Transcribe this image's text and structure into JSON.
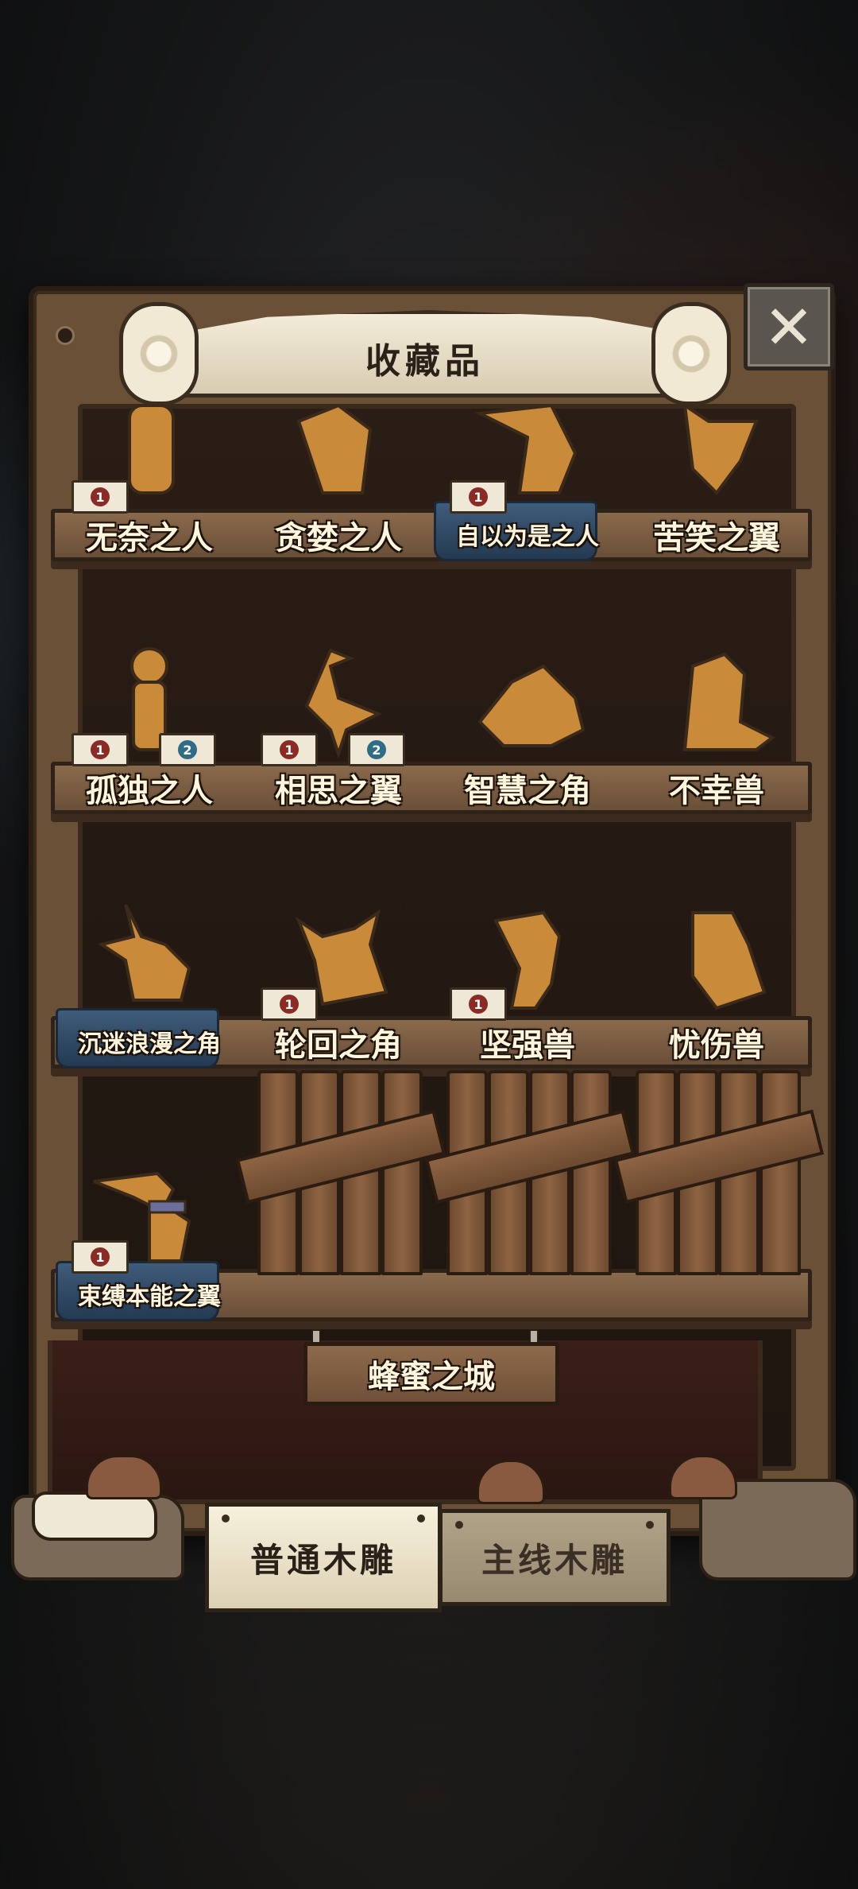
{
  "header": {
    "title": "收藏品",
    "close_icon": "close-x-icon"
  },
  "shelves": [
    {
      "items": [
        {
          "name": "无奈之人",
          "icon": "statue-kneeling-person",
          "tags": [
            {
              "n": "1",
              "c": "red"
            }
          ],
          "cloth": false,
          "small": false
        },
        {
          "name": "贪婪之人",
          "icon": "statue-crouching-person",
          "tags": [],
          "cloth": false,
          "small": false
        },
        {
          "name": "自以为是之人",
          "icon": "statue-bowing-person",
          "tags": [
            {
              "n": "1",
              "c": "red"
            }
          ],
          "cloth": true,
          "small": true
        },
        {
          "name": "苦笑之翼",
          "icon": "statue-bird",
          "tags": [],
          "cloth": false,
          "small": false
        }
      ]
    },
    {
      "items": [
        {
          "name": "孤独之人",
          "icon": "statue-girl",
          "tags": [
            {
              "n": "1",
              "c": "red"
            },
            {
              "n": "2",
              "c": "blue"
            }
          ],
          "cloth": false,
          "small": false
        },
        {
          "name": "相思之翼",
          "icon": "statue-heron",
          "tags": [
            {
              "n": "1",
              "c": "red"
            },
            {
              "n": "2",
              "c": "blue"
            }
          ],
          "cloth": false,
          "small": false
        },
        {
          "name": "智慧之角",
          "icon": "statue-turtle",
          "tags": [],
          "cloth": false,
          "small": false
        },
        {
          "name": "不幸兽",
          "icon": "statue-seal",
          "tags": [],
          "cloth": false,
          "small": false
        }
      ]
    },
    {
      "items": [
        {
          "name": "沉迷浪漫之角",
          "icon": "statue-dog-hat",
          "tags": [],
          "cloth": true,
          "small": true
        },
        {
          "name": "轮回之角",
          "icon": "statue-bull",
          "tags": [
            {
              "n": "1",
              "c": "red"
            }
          ],
          "cloth": false,
          "small": false
        },
        {
          "name": "坚强兽",
          "icon": "statue-mouse",
          "tags": [
            {
              "n": "1",
              "c": "red"
            }
          ],
          "cloth": false,
          "small": false
        },
        {
          "name": "忧伤兽",
          "icon": "statue-armadillo",
          "tags": [],
          "cloth": false,
          "small": false
        }
      ]
    },
    {
      "items": [
        {
          "name": "束缚本能之翼",
          "icon": "statue-pelican",
          "tags": [
            {
              "n": "1",
              "c": "red"
            }
          ],
          "cloth": true,
          "small": true
        },
        {
          "name": "",
          "icon": "boarded-locked",
          "tags": [],
          "cloth": false,
          "small": false
        },
        {
          "name": "",
          "icon": "boarded-locked",
          "tags": [],
          "cloth": false,
          "small": false
        },
        {
          "name": "",
          "icon": "boarded-locked",
          "tags": [],
          "cloth": false,
          "small": false
        }
      ]
    }
  ],
  "section_sign": "蜂蜜之城",
  "tabs": [
    {
      "label": "普通木雕",
      "active": true
    },
    {
      "label": "主线木雕",
      "active": false
    }
  ],
  "colors": {
    "wood": "#6b5038",
    "paper": "#f3ecd9",
    "carving": "#c98a3a",
    "badge_red": "#8b2b25",
    "badge_blue": "#2f6c86"
  }
}
